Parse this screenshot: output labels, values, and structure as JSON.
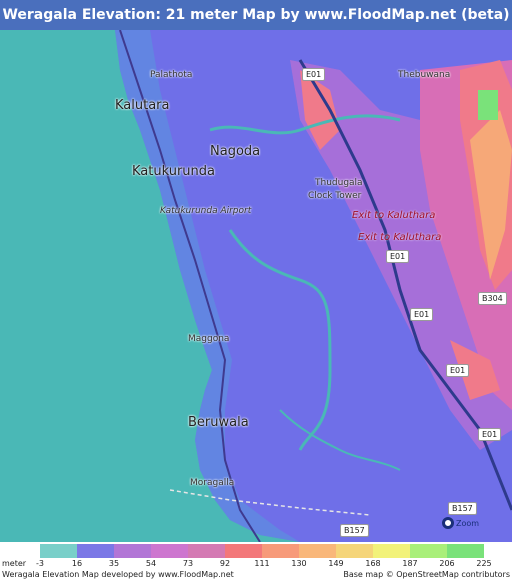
{
  "title": "Weragala Elevation: 21 meter Map by www.FloodMap.net (beta)",
  "map": {
    "places": [
      {
        "name": "Palathota",
        "size": "small"
      },
      {
        "name": "Kalutara",
        "size": "big"
      },
      {
        "name": "Nagoda",
        "size": "big"
      },
      {
        "name": "Katukurunda",
        "size": "big"
      },
      {
        "name": "Thudugala",
        "size": "small"
      },
      {
        "name": "Clock Tower",
        "size": "small"
      },
      {
        "name": "Maggona",
        "size": "small"
      },
      {
        "name": "Beruwala",
        "size": "big"
      },
      {
        "name": "Moragalla",
        "size": "small"
      },
      {
        "name": "Thebuwana",
        "size": "small"
      }
    ],
    "airport": "Katukurunda Airport",
    "exits": [
      "Exit to Kaluthara",
      "Exit to Kaluthara"
    ],
    "roads": [
      "E01",
      "E01",
      "E01",
      "E01",
      "E01",
      "B304",
      "B157",
      "B157"
    ],
    "zoom_label": "Zoom"
  },
  "legend": {
    "unit": "meter",
    "ticks": [
      "-3",
      "16",
      "35",
      "54",
      "73",
      "92",
      "111",
      "130",
      "149",
      "168",
      "187",
      "206",
      "225"
    ],
    "colors": [
      "#79cfc9",
      "#7b78e6",
      "#b276d6",
      "#cd76cf",
      "#d47ab3",
      "#f3787a",
      "#f79a7a",
      "#f9b77a",
      "#f5d57a",
      "#f2f27a",
      "#a9ef7a",
      "#7ae27a"
    ]
  },
  "footer": {
    "left": "Weragala Elevation Map developed by www.FloodMap.net",
    "right": "Base map © OpenStreetMap contributors"
  },
  "colors": {
    "title_bg": "#4a6fbd",
    "sea": "#4ab8b6",
    "low": "#6f6fe8",
    "mid": "#c070d6",
    "high": "#e46e9a",
    "peak": "#f4a070"
  }
}
